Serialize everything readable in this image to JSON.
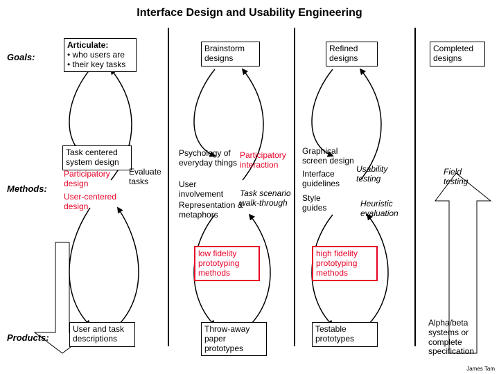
{
  "title": "Interface Design and Usability Engineering",
  "labels": {
    "goals": "Goals:",
    "methods": "Methods:",
    "products": "Products:"
  },
  "goals": {
    "articulate_title": "Articulate:",
    "articulate_b1": "• who users are",
    "articulate_b2": "• their key tasks",
    "brainstorm": "Brainstorm designs",
    "refined": "Refined designs",
    "completed": "Completed designs"
  },
  "methods": {
    "task_centered": "Task centered system design",
    "participatory_design": "Participatory design",
    "user_centered": "User-centered design",
    "evaluate_tasks": "Evaluate tasks",
    "psychology": "Psychology of everyday things",
    "user_involvement": "User involvement",
    "representation": "Representation & metaphors",
    "participatory_interaction": "Participatory interaction",
    "task_scenario": "Task scenario walk-through",
    "graphical": "Graphical screen design",
    "interface_guidelines": "Interface guidelines",
    "style_guides": "Style guides",
    "usability_testing": "Usability testing",
    "heuristic": "Heuristic evaluation",
    "field_testing": "Field testing"
  },
  "prototyping": {
    "low_fidelity": "low fidelity prototyping methods",
    "high_fidelity": "high fidelity prototyping methods"
  },
  "products": {
    "user_task_desc": "User and task descriptions",
    "throwaway": "Throw-away paper prototypes",
    "testable": "Testable prototypes",
    "alpha_beta": "Alpha/beta systems or complete specification"
  },
  "credit": "James Tam"
}
